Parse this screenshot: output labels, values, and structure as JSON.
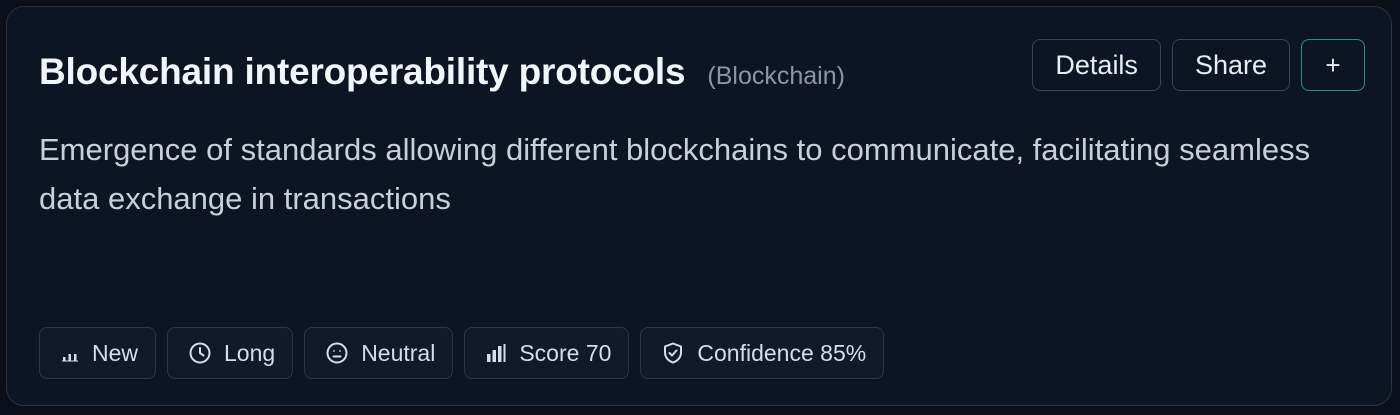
{
  "card": {
    "title": "Blockchain interoperability protocols",
    "category": "(Blockchain)",
    "description": "Emergence of standards allowing different blockchains to communicate, facilitating seamless data exchange in transactions"
  },
  "actions": {
    "details_label": "Details",
    "share_label": "Share",
    "add_label": "+"
  },
  "tags": [
    {
      "label": "New",
      "icon": "bar-chart-small-icon"
    },
    {
      "label": "Long",
      "icon": "clock-icon"
    },
    {
      "label": "Neutral",
      "icon": "neutral-face-icon"
    },
    {
      "label": "Score 70",
      "icon": "bar-chart-icon"
    },
    {
      "label": "Confidence 85%",
      "icon": "shield-check-icon"
    }
  ],
  "colors": {
    "background": "#0b0f1a",
    "card": "#0d1424",
    "border": "#2a3344",
    "accent": "#2f8f86",
    "muted_text": "#8a96aa"
  }
}
